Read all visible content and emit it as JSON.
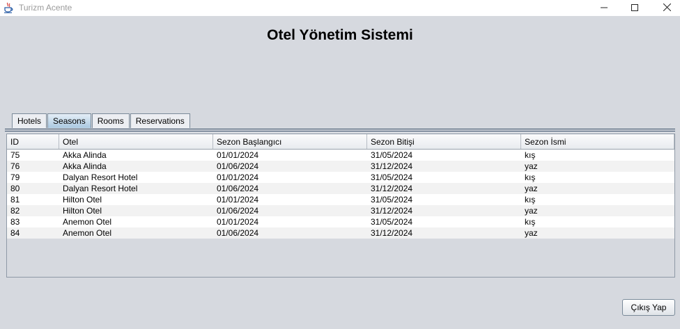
{
  "window": {
    "title": "Turizm Acente"
  },
  "heading": "Otel Yönetim Sistemi",
  "tabs": [
    {
      "label": "Hotels"
    },
    {
      "label": "Seasons"
    },
    {
      "label": "Rooms"
    },
    {
      "label": "Reservations"
    }
  ],
  "active_tab": "Seasons",
  "table": {
    "columns": [
      "ID",
      "Otel",
      "Sezon Başlangıcı",
      "Sezon Bitişi",
      "Sezon İsmi"
    ],
    "rows": [
      [
        "75",
        "Akka Alinda",
        "01/01/2024",
        "31/05/2024",
        "kış"
      ],
      [
        "76",
        "Akka Alinda",
        "01/06/2024",
        "31/12/2024",
        "yaz"
      ],
      [
        "79",
        "Dalyan Resort Hotel",
        "01/01/2024",
        "31/05/2024",
        "kış"
      ],
      [
        "80",
        "Dalyan Resort Hotel",
        "01/06/2024",
        "31/12/2024",
        "yaz"
      ],
      [
        "81",
        "Hilton Otel",
        "01/01/2024",
        "31/05/2024",
        "kış"
      ],
      [
        "82",
        "Hilton Otel",
        "01/06/2024",
        "31/12/2024",
        "yaz"
      ],
      [
        "83",
        "Anemon Otel",
        "01/01/2024",
        "31/05/2024",
        "kış"
      ],
      [
        "84",
        "Anemon Otel",
        "01/06/2024",
        "31/12/2024",
        "yaz"
      ]
    ]
  },
  "exit_button": {
    "label": "Çıkış Yap"
  },
  "icons": {
    "app": "java-cup-icon",
    "minimize": "minimize-icon",
    "maximize": "maximize-icon",
    "close": "close-icon"
  }
}
